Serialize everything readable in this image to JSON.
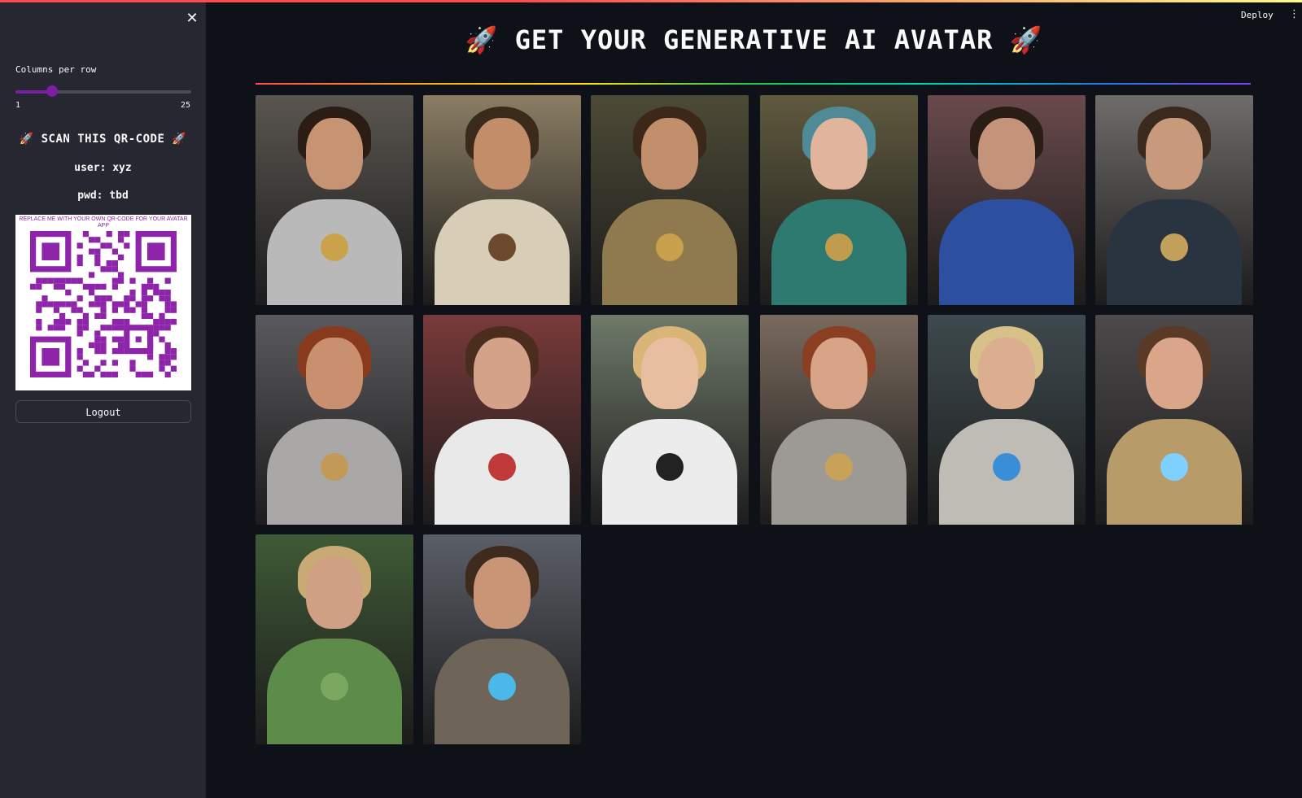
{
  "sidebar": {
    "close_icon": "close-icon",
    "slider": {
      "label": "Columns per row",
      "min": 1,
      "max": 25,
      "value": 6,
      "min_label": "1",
      "max_label": "25",
      "accent": "#7b1fa2"
    },
    "scan_title": "🚀 SCAN THIS QR-CODE 🚀",
    "user": "user: xyz",
    "pwd": "pwd: tbd",
    "qr": {
      "note": "REPLACE ME WITH YOUR OWN QR-CODE FOR YOUR AVATAR APP",
      "color": "#8e24aa"
    },
    "logout_label": "Logout"
  },
  "header": {
    "deploy_label": "Deploy",
    "menu_icon": "kebab-menu-icon"
  },
  "main": {
    "title": "🚀 GET YOUR GENERATIVE AI AVATAR 🚀"
  },
  "gallery": {
    "images": [
      {
        "name": "avatar-warrior-silver-armor"
      },
      {
        "name": "avatar-robed-hero"
      },
      {
        "name": "avatar-forest-knight-gold"
      },
      {
        "name": "avatar-teal-hair-armor"
      },
      {
        "name": "avatar-stadium-blue-jersey"
      },
      {
        "name": "avatar-cosmic-armor"
      },
      {
        "name": "avatar-red-hair-silver-armor"
      },
      {
        "name": "avatar-stadium-white-jersey"
      },
      {
        "name": "avatar-stadium-germany-jersey"
      },
      {
        "name": "avatar-red-hair-woman-armor"
      },
      {
        "name": "avatar-blonde-portal-armor"
      },
      {
        "name": "avatar-city-woman-armor"
      },
      {
        "name": "avatar-forest-leaf-armor"
      },
      {
        "name": "avatar-storm-glowing-armor"
      }
    ]
  }
}
